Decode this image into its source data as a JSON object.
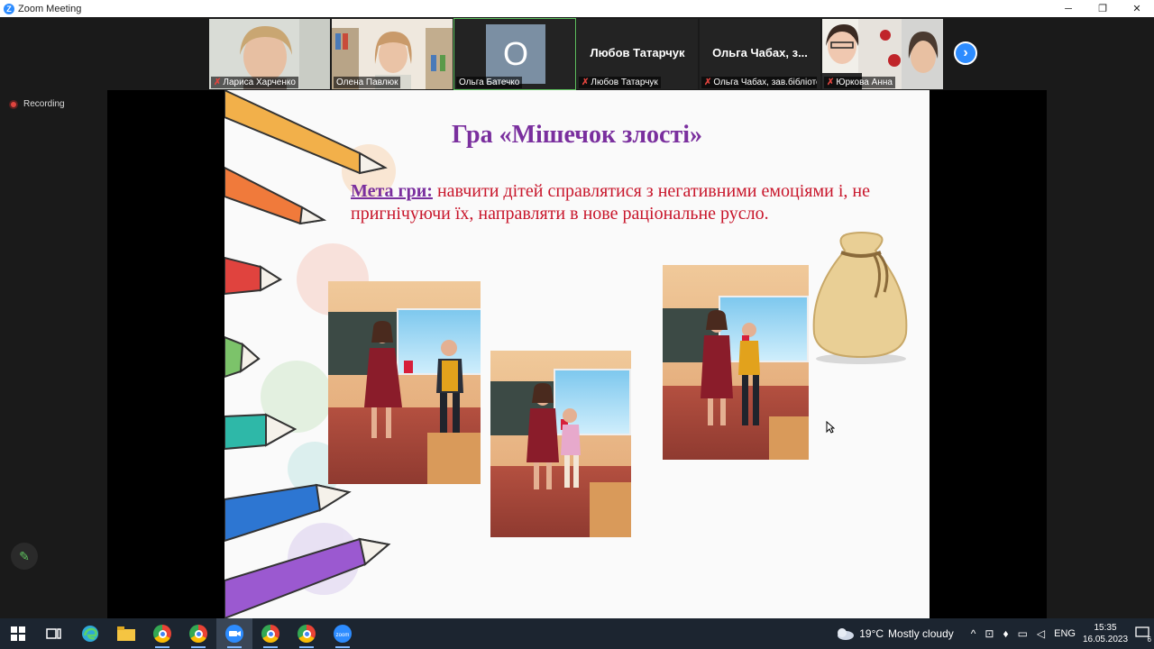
{
  "window": {
    "title": "Zoom Meeting",
    "logo": "Z",
    "minimize": "─",
    "maximize": "❐",
    "close": "✕"
  },
  "participants": [
    {
      "name": "Лариса Харченко",
      "muted": true,
      "kind": "video"
    },
    {
      "name": "Олена Павлюк",
      "muted": false,
      "kind": "video"
    },
    {
      "name": "Ольга Батечко",
      "muted": false,
      "kind": "avatar",
      "initial": "О",
      "active": true
    },
    {
      "name": "Любов Татарчук",
      "muted": true,
      "kind": "name",
      "display_name": "Любов Татарчук"
    },
    {
      "name": "Ольга Чабах, зав.бібліотекою",
      "muted": true,
      "kind": "name",
      "display_name": "Ольга Чабах, з..."
    },
    {
      "name": "Юркова Анна",
      "muted": true,
      "kind": "video"
    }
  ],
  "next_page_icon": "›",
  "recording": {
    "label": "Recording"
  },
  "slide": {
    "title": "Гра «Мішечок злості»",
    "goal_label": "Мета гри:",
    "goal_text": " навчити дітей справлятися з негативними емоціями і, не пригнічуючи їх, направляти в нове  раціональне  русло."
  },
  "annotate_icon": "✎",
  "taskbar": {
    "weather": {
      "temp": "19°C",
      "condition": "Mostly cloudy"
    },
    "language": "ENG",
    "time": "15:35",
    "date": "16.05.2023",
    "notifications": "6",
    "apps": [
      "windows-start",
      "task-view",
      "edge",
      "file-explorer",
      "chrome",
      "chrome-profile",
      "zoom-meeting",
      "chrome-profile-2",
      "chrome-profile-3",
      "zoom"
    ]
  },
  "colors": {
    "slide_title": "#7a2f9e",
    "slide_text": "#c8162b",
    "zoom_blue": "#2d8cff",
    "muted_red": "#e0443e"
  }
}
